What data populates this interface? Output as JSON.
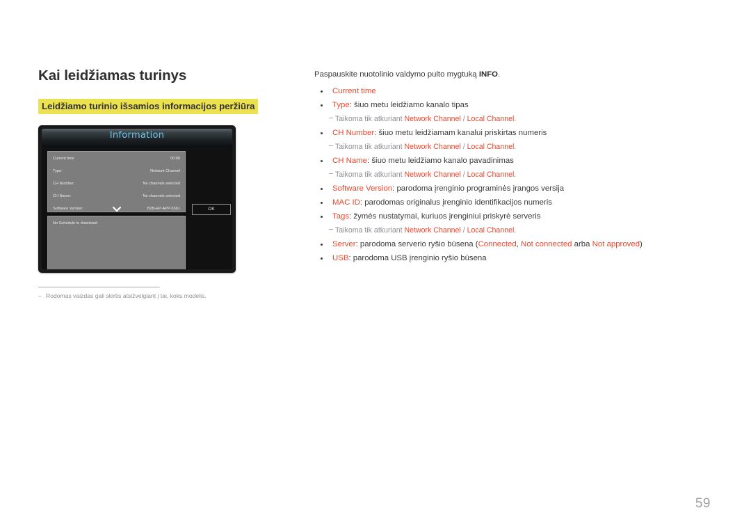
{
  "document": {
    "page_number": "59"
  },
  "left": {
    "title": "Kai leidžiamas turinys",
    "subtitle": "Leidžiamo turinio išsamios informacijos peržiūra",
    "footnote": {
      "dash": "–",
      "text": "Rodomas vaizdas gali skirtis atsižvelgiant į tai, koks modelis."
    }
  },
  "tv_screen": {
    "window_title": "Information",
    "chevron_icon": "❯",
    "rows": [
      {
        "label": "Current time",
        "value": "00:00"
      },
      {
        "label": "Type:",
        "value": "Network Channel"
      },
      {
        "label": "CH Number:",
        "value": "No channels selected"
      },
      {
        "label": "CH Name:",
        "value": "No channels selected"
      },
      {
        "label": "Software Version:",
        "value": "B2B-EP-APP-5561"
      }
    ],
    "schedule_text": "No Schedule to download",
    "ok_button": "OK"
  },
  "right": {
    "intro_pre": "Paspauskite nuotolinio valdymo pulto mygtuką ",
    "intro_bold": "INFO",
    "intro_post": ".",
    "note_prefix": "Taikoma tik atkuriant ",
    "note_ch1": "Network Channel",
    "note_sep": " / ",
    "note_ch2": "Local Channel",
    "note_end": ".",
    "items": {
      "current_time": "Current time",
      "type_label": "Type",
      "type_desc": ": šiuo metu leidžiamo kanalo tipas",
      "ch_number_label": "CH Number",
      "ch_number_desc": ": šiuo metu leidžiamam kanalui priskirtas numeris",
      "ch_name_label": "CH Name",
      "ch_name_desc": ": šiuo metu leidžiamo kanalo pavadinimas",
      "software_version_label": "Software Version",
      "software_version_desc": ": parodoma įrenginio programinės įrangos versija",
      "mac_id_label": "MAC ID",
      "mac_id_desc": ": parodomas originalus įrenginio identifikacijos numeris",
      "tags_label": "Tags",
      "tags_desc": ": žymės nustatymai, kuriuos įrenginiui priskyrė serveris",
      "server_label": "Server",
      "server_desc_pre": ": parodoma serverio ryšio būsena (",
      "server_state_1": "Connected",
      "server_sep_1": ", ",
      "server_state_2": "Not connected",
      "server_sep_2": " arba ",
      "server_state_3": "Not approved",
      "server_desc_post": ")",
      "usb_label": "USB",
      "usb_desc": ": parodoma USB įrenginio ryšio būsena"
    }
  },
  "colors": {
    "accent": "#e8472c",
    "highlight": "#ece14f",
    "note_gray": "#8e8e94",
    "body": "#3b3b3b"
  }
}
